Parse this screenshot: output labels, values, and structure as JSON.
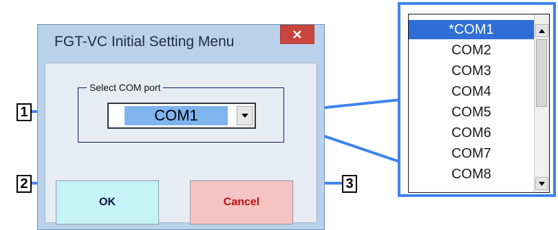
{
  "dialog": {
    "title": "FGT-VC Initial Setting Menu",
    "close_icon": "close-x-icon",
    "group_label": "Select COM port",
    "selected_port": "COM1",
    "ok_label": "OK",
    "cancel_label": "Cancel"
  },
  "dropdown": {
    "items": [
      "*COM1",
      "COM2",
      "COM3",
      "COM4",
      "COM5",
      "COM6",
      "COM7",
      "COM8"
    ],
    "selected_index": 0
  },
  "callouts": [
    "1",
    "2",
    "3"
  ],
  "colors": {
    "accent_line": "#3f83ee",
    "selection": "#2f6ed6",
    "close_button": "#c7453d",
    "ok_button": "#c4f3f8",
    "cancel_button": "#f6c3c3"
  }
}
